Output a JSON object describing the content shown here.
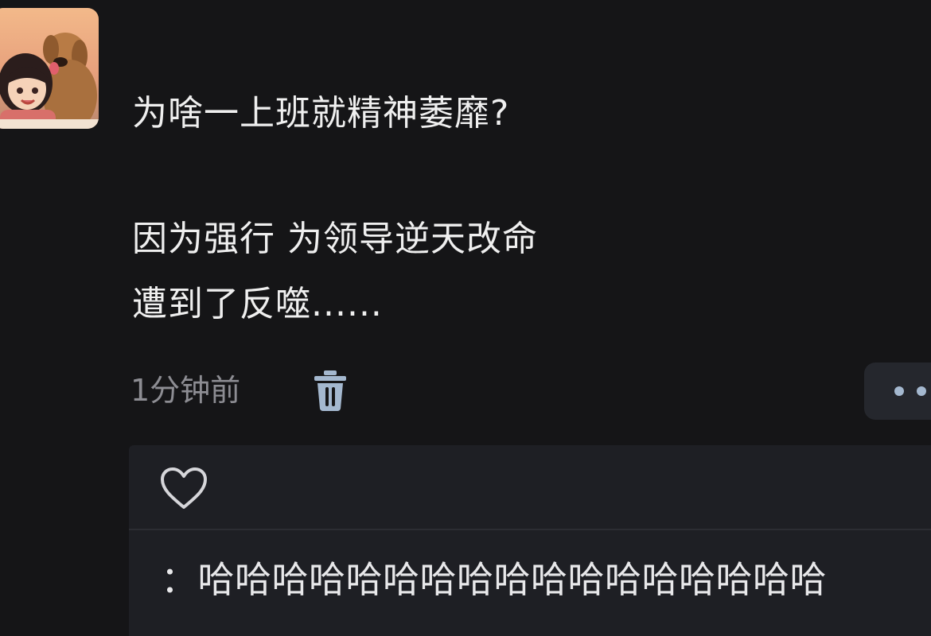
{
  "post": {
    "line1": "为啥一上班就精神萎靡?",
    "line2": "因为强行 为领导逆天改命",
    "line3": "遭到了反噬......"
  },
  "meta": {
    "timestamp": "1分钟前"
  },
  "comment": {
    "text": "：哈哈哈哈哈哈哈哈哈哈哈哈哈哈哈哈哈"
  },
  "icons": {
    "delete": "trash-icon",
    "like": "heart-icon",
    "more": "more-icon",
    "avatar": "avatar-image"
  },
  "colors": {
    "background": "#151517",
    "panel": "#1e1f24",
    "muted_text": "#8d8d93",
    "icon_blue": "#a4b8cf"
  }
}
